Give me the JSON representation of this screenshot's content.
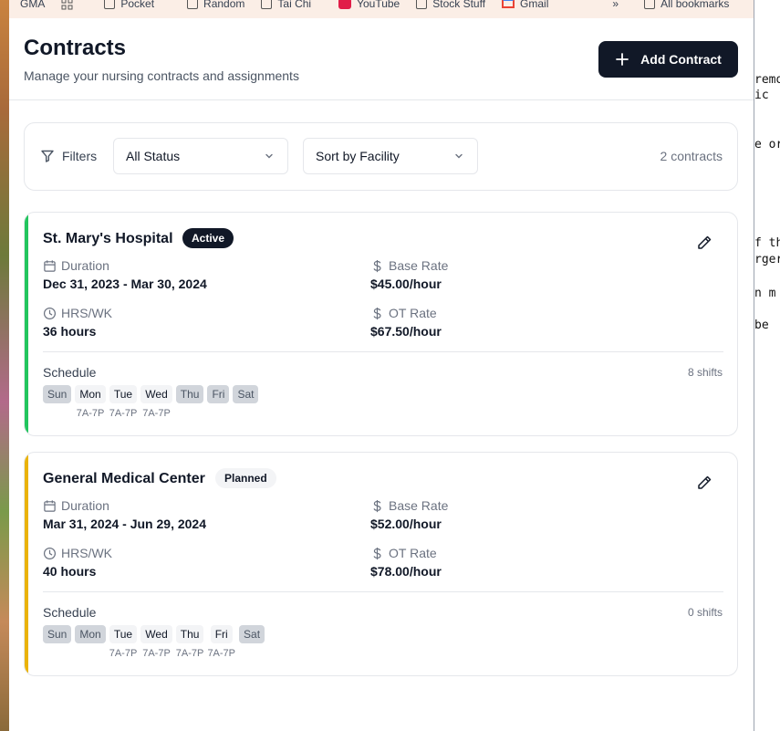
{
  "bookmarks": [
    {
      "label": "GMA",
      "icon": "bookmark-icon"
    },
    {
      "label": "",
      "icon": "apps-grid-icon"
    },
    {
      "label": "Pocket",
      "icon": "folder-icon"
    },
    {
      "label": "Random",
      "icon": "folder-icon"
    },
    {
      "label": "Tai Chi",
      "icon": "folder-icon"
    },
    {
      "label": "YouTube",
      "icon": "youtube-icon"
    },
    {
      "label": "Stock Stuff",
      "icon": "folder-icon"
    },
    {
      "label": "Gmail",
      "icon": "gmail-icon"
    }
  ],
  "bookmarks_overflow": "»",
  "all_bookmarks": "All bookmarks",
  "header": {
    "title": "Contracts",
    "subtitle": "Manage your nursing contracts and assignments",
    "add_button": "Add Contract"
  },
  "filters": {
    "label": "Filters",
    "status_select": "All Status",
    "sort_select": "Sort by Facility",
    "count": "2 contracts"
  },
  "contracts": [
    {
      "facility": "St. Mary's Hospital",
      "status": "Active",
      "accent_color": "#22c55e",
      "duration_label": "Duration",
      "duration": "Dec 31, 2023 - Mar 30, 2024",
      "base_rate_label": "Base Rate",
      "base_rate": "$45.00/hour",
      "hrs_label": "HRS/WK",
      "hrs": "36 hours",
      "ot_rate_label": "OT Rate",
      "ot_rate": "$67.50/hour",
      "schedule_label": "Schedule",
      "shifts": "8 shifts",
      "days": [
        {
          "day": "Sun",
          "active": false,
          "time": ""
        },
        {
          "day": "Mon",
          "active": true,
          "time": "7A-7P"
        },
        {
          "day": "Tue",
          "active": true,
          "time": "7A-7P"
        },
        {
          "day": "Wed",
          "active": true,
          "time": "7A-7P"
        },
        {
          "day": "Thu",
          "active": false,
          "time": ""
        },
        {
          "day": "Fri",
          "active": false,
          "time": ""
        },
        {
          "day": "Sat",
          "active": false,
          "time": ""
        }
      ]
    },
    {
      "facility": "General Medical Center",
      "status": "Planned",
      "accent_color": "#eab308",
      "duration_label": "Duration",
      "duration": "Mar 31, 2024 - Jun 29, 2024",
      "base_rate_label": "Base Rate",
      "base_rate": "$52.00/hour",
      "hrs_label": "HRS/WK",
      "hrs": "40 hours",
      "ot_rate_label": "OT Rate",
      "ot_rate": "$78.00/hour",
      "schedule_label": "Schedule",
      "shifts": "0 shifts",
      "days": [
        {
          "day": "Sun",
          "active": false,
          "time": ""
        },
        {
          "day": "Mon",
          "active": false,
          "time": ""
        },
        {
          "day": "Tue",
          "active": true,
          "time": "7A-7P"
        },
        {
          "day": "Wed",
          "active": true,
          "time": "7A-7P"
        },
        {
          "day": "Thu",
          "active": true,
          "time": "7A-7P"
        },
        {
          "day": "Fri",
          "active": true,
          "time": "7A-7P"
        },
        {
          "day": "Sat",
          "active": false,
          "time": ""
        }
      ]
    }
  ],
  "background_terminal_lines": [
    "remo",
    "ic",
    "e or",
    "f th",
    "rger",
    "n  m",
    " be"
  ]
}
